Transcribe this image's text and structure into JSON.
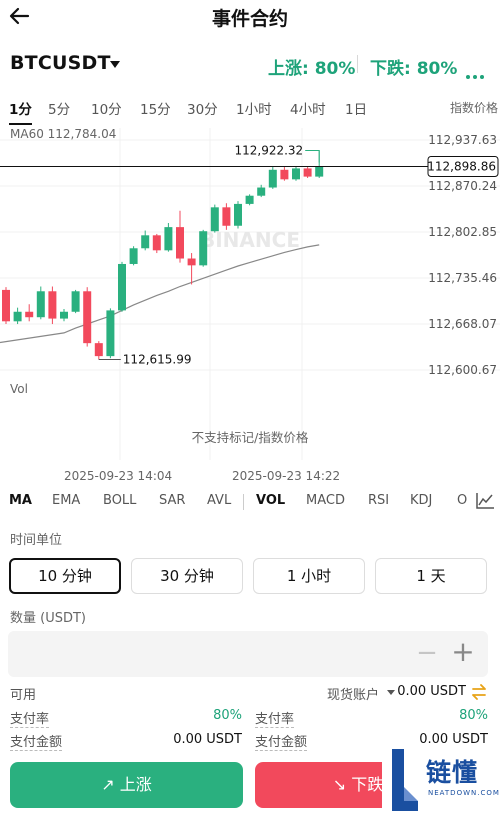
{
  "header": {
    "title": "事件合约"
  },
  "symbol_row": {
    "symbol": "BTCUSDT",
    "rise": "上涨: 80%",
    "fall": "下跌: 80%"
  },
  "timeframes": [
    "1分",
    "5分",
    "10分",
    "15分",
    "30分",
    "1小时",
    "4小时",
    "1日"
  ],
  "active_timeframe": "1分",
  "index_price_label": "指数价格",
  "chart": {
    "ma_label": "MA60 112,784.04",
    "price_ticks": [
      "112,937.63",
      "112,870.24",
      "112,802.85",
      "112,735.46",
      "112,668.07",
      "112,600.67"
    ],
    "current_price": "112,898.86",
    "high_label": "112,922.32",
    "low_label": "112,615.99",
    "watermark": "BINANCE",
    "vol_label": "Vol",
    "no_support": "不支持标记/指数价格",
    "time_labels": [
      "2025-09-23 14:04",
      "2025-09-23 14:22"
    ]
  },
  "chart_data": {
    "type": "candlestick",
    "y_ticks": [
      112937.63,
      112870.24,
      112802.85,
      112735.46,
      112668.07,
      112600.67
    ],
    "ylim": [
      112600.67,
      112937.63
    ],
    "last_price": 112898.86,
    "high": 112922.32,
    "low": 112615.99,
    "ma60_last": 112784.04,
    "candles": [
      {
        "o": 112718,
        "h": 112722,
        "l": 112668,
        "c": 112672
      },
      {
        "o": 112672,
        "h": 112692,
        "l": 112668,
        "c": 112686
      },
      {
        "o": 112686,
        "h": 112697,
        "l": 112672,
        "c": 112678
      },
      {
        "o": 112678,
        "h": 112723,
        "l": 112675,
        "c": 112716
      },
      {
        "o": 112716,
        "h": 112723,
        "l": 112668,
        "c": 112676
      },
      {
        "o": 112676,
        "h": 112690,
        "l": 112672,
        "c": 112686
      },
      {
        "o": 112686,
        "h": 112718,
        "l": 112684,
        "c": 112716
      },
      {
        "o": 112716,
        "h": 112722,
        "l": 112635,
        "c": 112640
      },
      {
        "o": 112640,
        "h": 112643,
        "l": 112616,
        "c": 112621
      },
      {
        "o": 112621,
        "h": 112691,
        "l": 112618,
        "c": 112688
      },
      {
        "o": 112688,
        "h": 112759,
        "l": 112686,
        "c": 112756
      },
      {
        "o": 112756,
        "h": 112782,
        "l": 112754,
        "c": 112779
      },
      {
        "o": 112779,
        "h": 112805,
        "l": 112776,
        "c": 112798
      },
      {
        "o": 112798,
        "h": 112800,
        "l": 112772,
        "c": 112776
      },
      {
        "o": 112776,
        "h": 112816,
        "l": 112774,
        "c": 112810
      },
      {
        "o": 112810,
        "h": 112834,
        "l": 112758,
        "c": 112764
      },
      {
        "o": 112764,
        "h": 112772,
        "l": 112726,
        "c": 112754
      },
      {
        "o": 112754,
        "h": 112806,
        "l": 112752,
        "c": 112804
      },
      {
        "o": 112804,
        "h": 112843,
        "l": 112802,
        "c": 112839
      },
      {
        "o": 112839,
        "h": 112845,
        "l": 112806,
        "c": 112812
      },
      {
        "o": 112812,
        "h": 112848,
        "l": 112808,
        "c": 112844
      },
      {
        "o": 112844,
        "h": 112858,
        "l": 112842,
        "c": 112856
      },
      {
        "o": 112856,
        "h": 112872,
        "l": 112854,
        "c": 112868
      },
      {
        "o": 112868,
        "h": 112898,
        "l": 112866,
        "c": 112894
      },
      {
        "o": 112894,
        "h": 112898,
        "l": 112878,
        "c": 112880
      },
      {
        "o": 112880,
        "h": 112898,
        "l": 112878,
        "c": 112896
      },
      {
        "o": 112896,
        "h": 112899,
        "l": 112882,
        "c": 112884
      },
      {
        "o": 112884,
        "h": 112922,
        "l": 112882,
        "c": 112899
      }
    ],
    "ma60": [
      112655,
      112662,
      112668,
      112674,
      112680,
      112688,
      112696,
      112703,
      112710,
      112716,
      112723,
      112729,
      112735,
      112741,
      112747,
      112753,
      112758,
      112763,
      112768,
      112773,
      112777,
      112781,
      112784
    ],
    "colors": {
      "up": "#2ab07f",
      "down": "#f2495c",
      "ma": "#888888"
    }
  },
  "indicators": [
    "MA",
    "EMA",
    "BOLL",
    "SAR",
    "AVL",
    "VOL",
    "MACD",
    "RSI",
    "KDJ",
    "O"
  ],
  "active_main_indicator": "MA",
  "active_sub_indicator": "VOL",
  "time_unit": {
    "label": "时间单位",
    "options": [
      "10 分钟",
      "30 分钟",
      "1 小时",
      "1 天"
    ],
    "selected": "10 分钟"
  },
  "quantity": {
    "label": "数量 (USDT)",
    "value": ""
  },
  "account": {
    "available_label": "可用",
    "account_name": "现货账户",
    "available_value": "0.00 USDT",
    "left": {
      "rate_label": "支付率",
      "rate_value": "80%",
      "amount_label": "支付金额",
      "amount_value": "0.00 USDT"
    },
    "right": {
      "rate_label": "支付率",
      "rate_value": "80%",
      "amount_label": "支付金额",
      "amount_value": "0.00 USDT"
    }
  },
  "actions": {
    "rise": "上涨",
    "fall": "下跌"
  },
  "watermark_logo": {
    "text": "链懂",
    "sub": "NEATDOWN.COM"
  },
  "colors": {
    "accent_green": "#1ea37a",
    "up": "#2ab07f",
    "down": "#f2495c",
    "logo_blue": "#1a4fa0"
  }
}
